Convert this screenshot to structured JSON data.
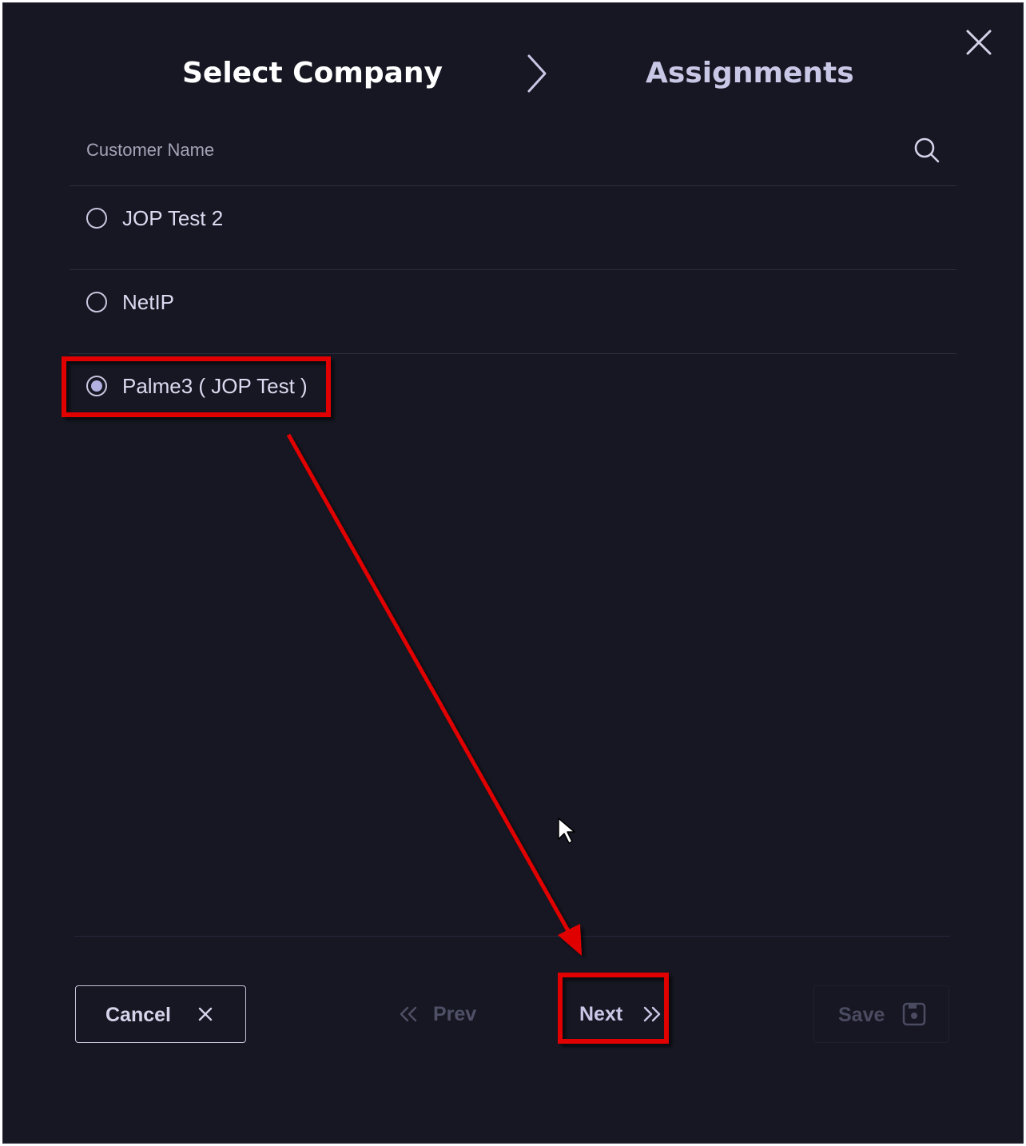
{
  "header": {
    "step1_title": "Select Company",
    "step2_title": "Assignments"
  },
  "search": {
    "placeholder": "Customer Name",
    "value": ""
  },
  "companies": [
    {
      "label": "JOP Test 2",
      "selected": false
    },
    {
      "label": "NetIP",
      "selected": false
    },
    {
      "label": "Palme3 ( JOP Test )",
      "selected": true
    }
  ],
  "footer": {
    "cancel_label": "Cancel",
    "prev_label": "Prev",
    "next_label": "Next",
    "save_label": "Save"
  },
  "colors": {
    "dialog_bg": "#161722",
    "accent": "#b3b0e2",
    "annotation": "#e00000"
  },
  "icons": {
    "close": "close-icon",
    "step_separator": "chevron-right-icon",
    "search": "search-icon",
    "cancel": "close-icon",
    "prev": "double-chevron-left-icon",
    "next": "double-chevron-right-icon",
    "save": "save-disk-icon",
    "cursor": "mouse-pointer-icon"
  }
}
